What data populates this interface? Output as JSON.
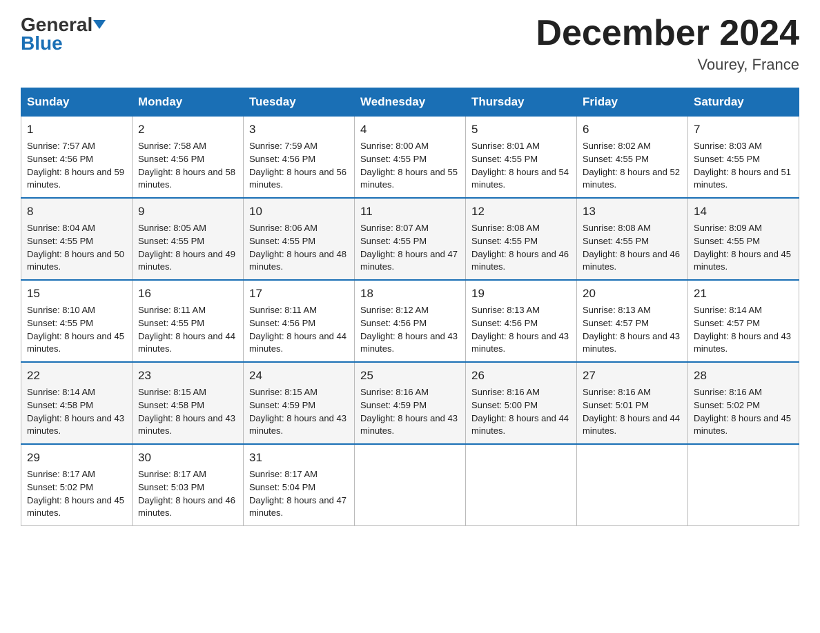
{
  "header": {
    "logo_general": "General",
    "logo_blue": "Blue",
    "month_title": "December 2024",
    "location": "Vourey, France"
  },
  "days_of_week": [
    "Sunday",
    "Monday",
    "Tuesday",
    "Wednesday",
    "Thursday",
    "Friday",
    "Saturday"
  ],
  "weeks": [
    {
      "days": [
        {
          "num": "1",
          "sunrise": "7:57 AM",
          "sunset": "4:56 PM",
          "daylight": "8 hours and 59 minutes."
        },
        {
          "num": "2",
          "sunrise": "7:58 AM",
          "sunset": "4:56 PM",
          "daylight": "8 hours and 58 minutes."
        },
        {
          "num": "3",
          "sunrise": "7:59 AM",
          "sunset": "4:56 PM",
          "daylight": "8 hours and 56 minutes."
        },
        {
          "num": "4",
          "sunrise": "8:00 AM",
          "sunset": "4:55 PM",
          "daylight": "8 hours and 55 minutes."
        },
        {
          "num": "5",
          "sunrise": "8:01 AM",
          "sunset": "4:55 PM",
          "daylight": "8 hours and 54 minutes."
        },
        {
          "num": "6",
          "sunrise": "8:02 AM",
          "sunset": "4:55 PM",
          "daylight": "8 hours and 52 minutes."
        },
        {
          "num": "7",
          "sunrise": "8:03 AM",
          "sunset": "4:55 PM",
          "daylight": "8 hours and 51 minutes."
        }
      ]
    },
    {
      "days": [
        {
          "num": "8",
          "sunrise": "8:04 AM",
          "sunset": "4:55 PM",
          "daylight": "8 hours and 50 minutes."
        },
        {
          "num": "9",
          "sunrise": "8:05 AM",
          "sunset": "4:55 PM",
          "daylight": "8 hours and 49 minutes."
        },
        {
          "num": "10",
          "sunrise": "8:06 AM",
          "sunset": "4:55 PM",
          "daylight": "8 hours and 48 minutes."
        },
        {
          "num": "11",
          "sunrise": "8:07 AM",
          "sunset": "4:55 PM",
          "daylight": "8 hours and 47 minutes."
        },
        {
          "num": "12",
          "sunrise": "8:08 AM",
          "sunset": "4:55 PM",
          "daylight": "8 hours and 46 minutes."
        },
        {
          "num": "13",
          "sunrise": "8:08 AM",
          "sunset": "4:55 PM",
          "daylight": "8 hours and 46 minutes."
        },
        {
          "num": "14",
          "sunrise": "8:09 AM",
          "sunset": "4:55 PM",
          "daylight": "8 hours and 45 minutes."
        }
      ]
    },
    {
      "days": [
        {
          "num": "15",
          "sunrise": "8:10 AM",
          "sunset": "4:55 PM",
          "daylight": "8 hours and 45 minutes."
        },
        {
          "num": "16",
          "sunrise": "8:11 AM",
          "sunset": "4:55 PM",
          "daylight": "8 hours and 44 minutes."
        },
        {
          "num": "17",
          "sunrise": "8:11 AM",
          "sunset": "4:56 PM",
          "daylight": "8 hours and 44 minutes."
        },
        {
          "num": "18",
          "sunrise": "8:12 AM",
          "sunset": "4:56 PM",
          "daylight": "8 hours and 43 minutes."
        },
        {
          "num": "19",
          "sunrise": "8:13 AM",
          "sunset": "4:56 PM",
          "daylight": "8 hours and 43 minutes."
        },
        {
          "num": "20",
          "sunrise": "8:13 AM",
          "sunset": "4:57 PM",
          "daylight": "8 hours and 43 minutes."
        },
        {
          "num": "21",
          "sunrise": "8:14 AM",
          "sunset": "4:57 PM",
          "daylight": "8 hours and 43 minutes."
        }
      ]
    },
    {
      "days": [
        {
          "num": "22",
          "sunrise": "8:14 AM",
          "sunset": "4:58 PM",
          "daylight": "8 hours and 43 minutes."
        },
        {
          "num": "23",
          "sunrise": "8:15 AM",
          "sunset": "4:58 PM",
          "daylight": "8 hours and 43 minutes."
        },
        {
          "num": "24",
          "sunrise": "8:15 AM",
          "sunset": "4:59 PM",
          "daylight": "8 hours and 43 minutes."
        },
        {
          "num": "25",
          "sunrise": "8:16 AM",
          "sunset": "4:59 PM",
          "daylight": "8 hours and 43 minutes."
        },
        {
          "num": "26",
          "sunrise": "8:16 AM",
          "sunset": "5:00 PM",
          "daylight": "8 hours and 44 minutes."
        },
        {
          "num": "27",
          "sunrise": "8:16 AM",
          "sunset": "5:01 PM",
          "daylight": "8 hours and 44 minutes."
        },
        {
          "num": "28",
          "sunrise": "8:16 AM",
          "sunset": "5:02 PM",
          "daylight": "8 hours and 45 minutes."
        }
      ]
    },
    {
      "days": [
        {
          "num": "29",
          "sunrise": "8:17 AM",
          "sunset": "5:02 PM",
          "daylight": "8 hours and 45 minutes."
        },
        {
          "num": "30",
          "sunrise": "8:17 AM",
          "sunset": "5:03 PM",
          "daylight": "8 hours and 46 minutes."
        },
        {
          "num": "31",
          "sunrise": "8:17 AM",
          "sunset": "5:04 PM",
          "daylight": "8 hours and 47 minutes."
        },
        null,
        null,
        null,
        null
      ]
    }
  ],
  "labels": {
    "sunrise": "Sunrise:",
    "sunset": "Sunset:",
    "daylight": "Daylight:"
  }
}
